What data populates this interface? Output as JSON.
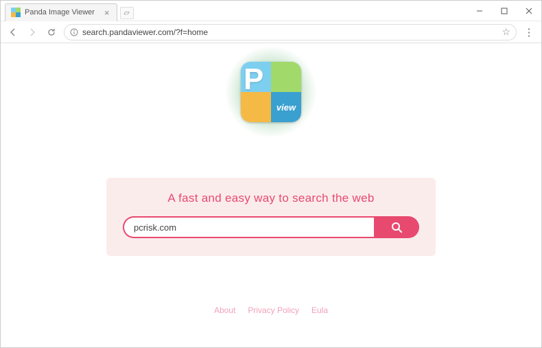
{
  "window": {
    "tab_title": "Panda Image Viewer",
    "url": "search.pandaviewer.com/?f=home"
  },
  "logo": {
    "letter": "P",
    "subtext": "view"
  },
  "search": {
    "tagline": "A fast and easy way to search the web",
    "value": "pcrisk.com"
  },
  "footer": {
    "about": "About",
    "privacy": "Privacy Policy",
    "eula": "Eula"
  }
}
